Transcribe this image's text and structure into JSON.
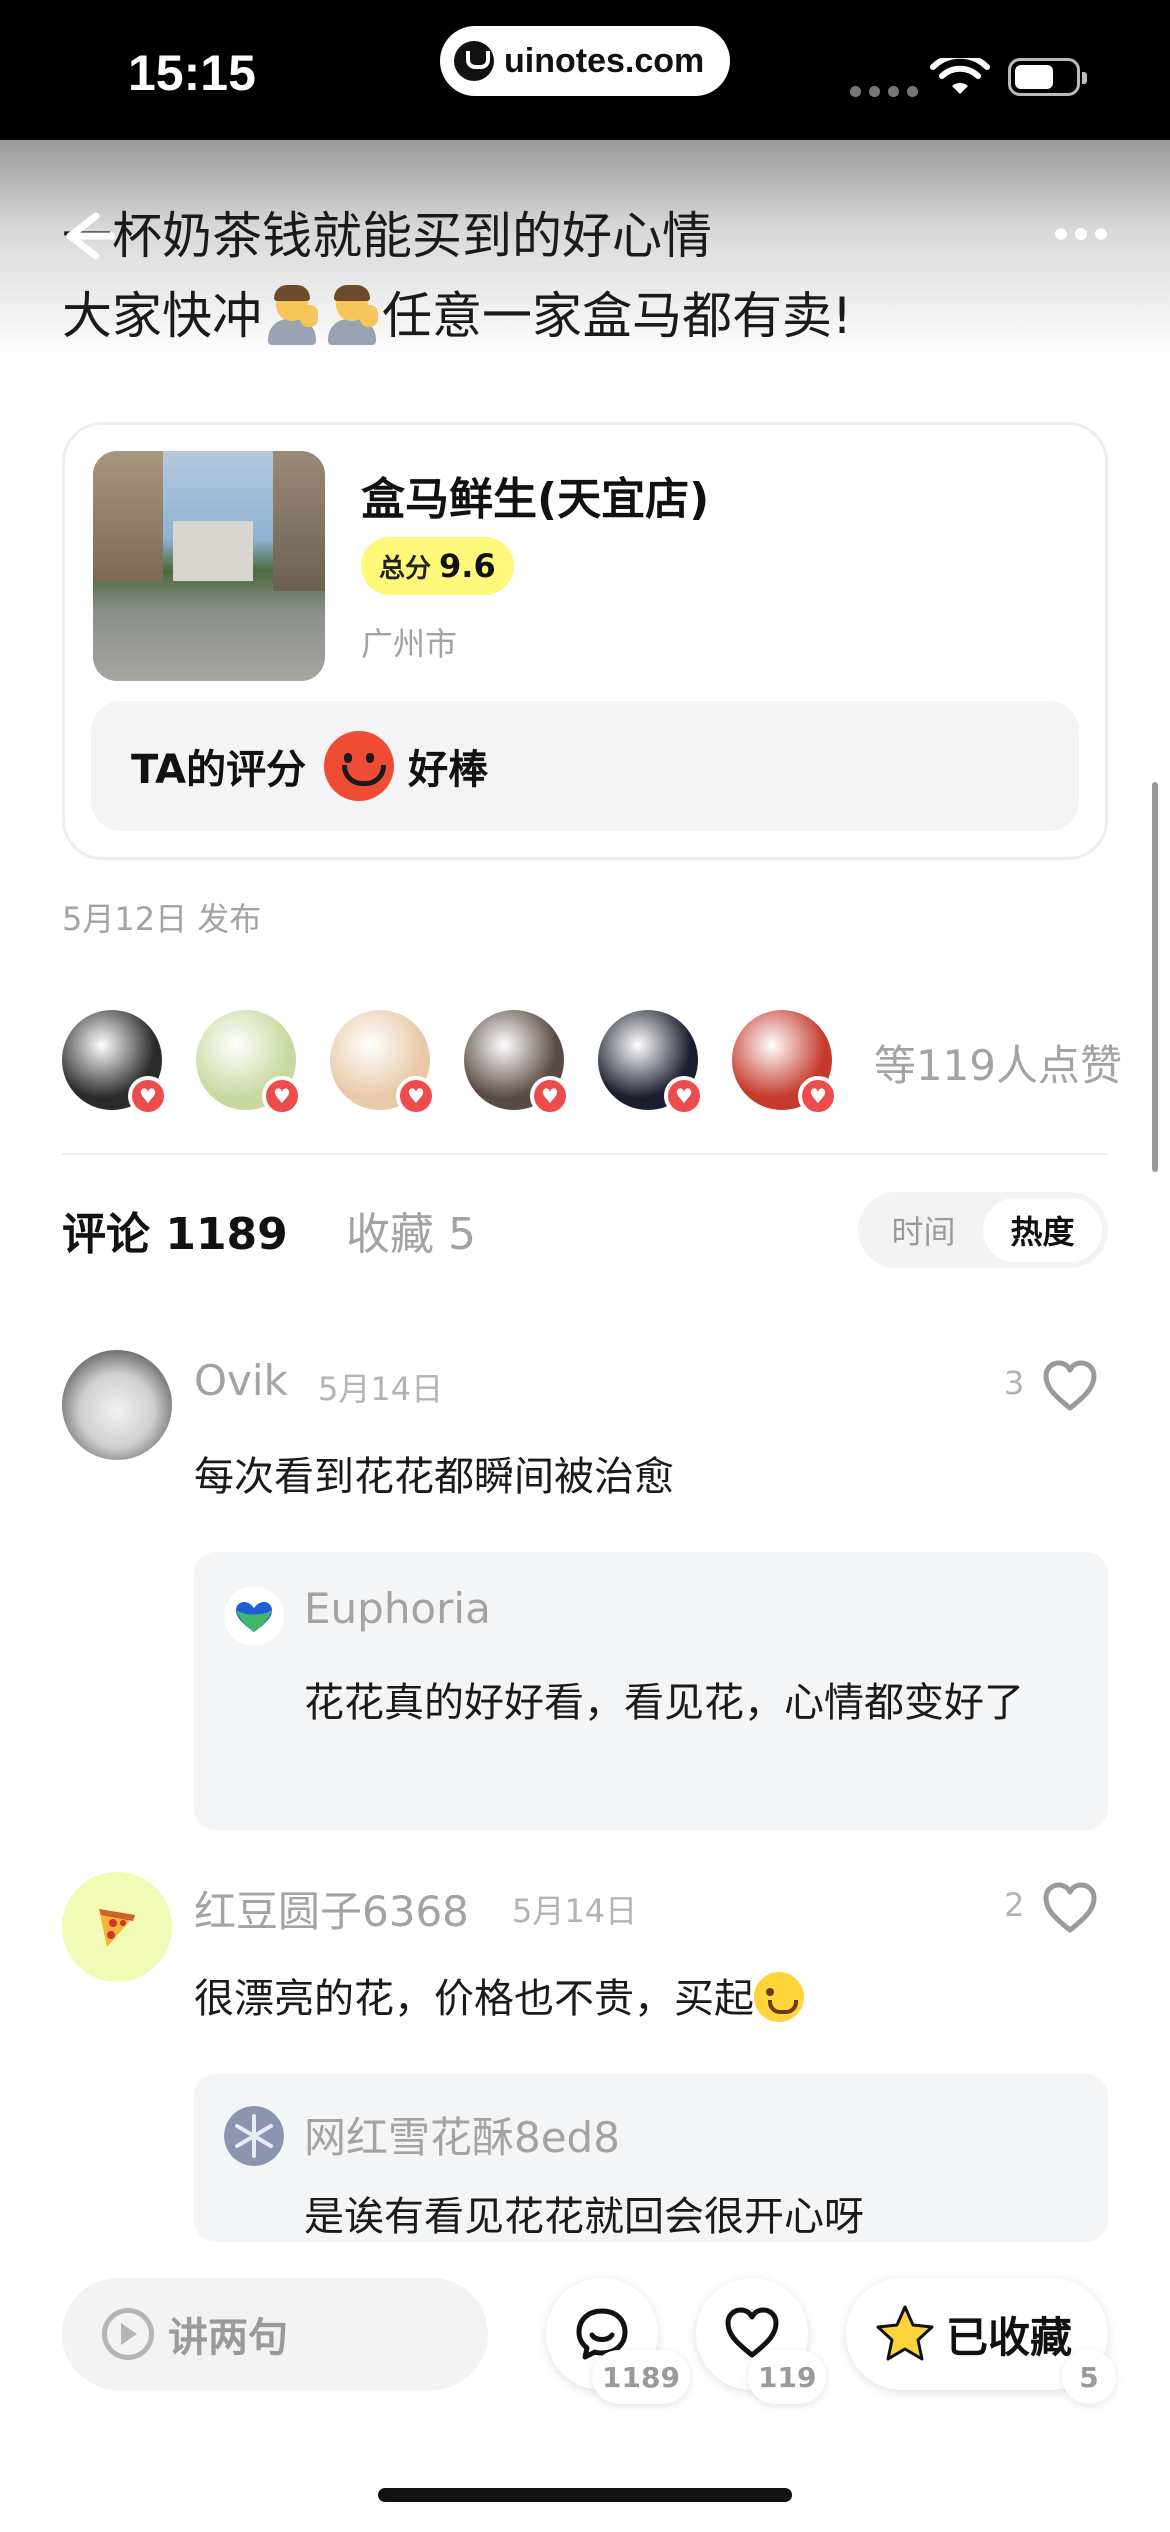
{
  "status_bar": {
    "time": "15:15",
    "url": "uinotes.com"
  },
  "post": {
    "text_line1": "一杯奶茶钱就能买到的好心情",
    "text_line2_part1": "大家快冲",
    "text_line2_part2": "任意一家盒马都有卖!",
    "publish_date": "5月12日 发布"
  },
  "shop": {
    "name": "盒马鲜生(天宜店)",
    "score_label": "总分",
    "score_value": "9.6",
    "city": "广州市",
    "rating_label": "TA的评分",
    "rating_value": "好棒"
  },
  "likers": {
    "count_text": "等119人点赞",
    "avatar_colors": [
      "#2a2a2a",
      "#c8d9a0",
      "#e8c9a8",
      "#5a4a44",
      "#1b1e2e",
      "#c43a2c"
    ]
  },
  "tabs": {
    "comments_label": "评论",
    "comments_count": "1189",
    "favorites_label": "收藏",
    "favorites_count": "5",
    "sort_time": "时间",
    "sort_hot": "热度",
    "active_sort": "热度"
  },
  "comments": [
    {
      "user": "Ovik",
      "date": "5月14日",
      "likes": "3",
      "text": "每次看到花花都瞬间被治愈",
      "reply": {
        "user": "Euphoria",
        "text": "花花真的好好看，看见花，心情都变好了"
      }
    },
    {
      "user": "红豆圆子6368",
      "date": "5月14日",
      "likes": "2",
      "text": "很漂亮的花，价格也不贵，买起",
      "reply": {
        "user": "网红雪花酥8ed8",
        "text": "是诶有看见花花就回会很开心呀"
      }
    }
  ],
  "bottom_bar": {
    "input_placeholder": "讲两句",
    "comment_count": "1189",
    "like_count": "119",
    "favorite_label": "已收藏",
    "favorite_count": "5"
  },
  "colors": {
    "accent_red": "#ee4c35",
    "score_yellow": "#fff87a",
    "star_yellow": "#ffd43b",
    "muted_text": "#a3a3a3"
  }
}
